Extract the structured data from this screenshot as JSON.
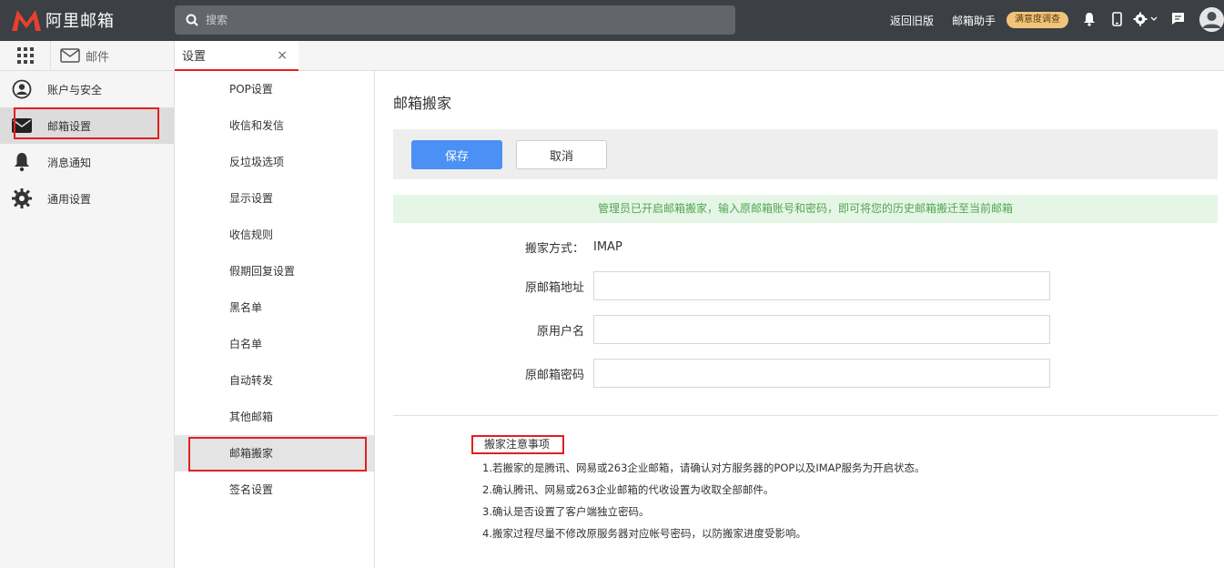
{
  "app": {
    "logo_text": "阿里邮箱"
  },
  "search": {
    "placeholder": "搜索"
  },
  "header": {
    "back_old": "返回旧版",
    "assistant": "邮箱助手",
    "survey": "满意度调查"
  },
  "leftnav": {
    "mail_label": "邮件",
    "items": [
      {
        "label": "账户与安全",
        "icon": "user-circle-icon"
      },
      {
        "label": "邮箱设置",
        "icon": "envelope-icon"
      },
      {
        "label": "消息通知",
        "icon": "bell-icon"
      },
      {
        "label": "通用设置",
        "icon": "gear-icon"
      }
    ]
  },
  "tab": {
    "label": "设置",
    "close": "×"
  },
  "submenu": {
    "items": [
      "POP设置",
      "收信和发信",
      "反垃圾选项",
      "显示设置",
      "收信规则",
      "假期回复设置",
      "黑名单",
      "白名单",
      "自动转发",
      "其他邮箱",
      "邮箱搬家",
      "签名设置"
    ]
  },
  "main": {
    "title": "邮箱搬家",
    "save": "保存",
    "cancel": "取消",
    "notice": "管理员已开启邮箱搬家，输入原邮箱账号和密码，即可将您的历史邮箱搬迁至当前邮箱",
    "method_label": "搬家方式：",
    "method_value": "IMAP",
    "address_label": "原邮箱地址",
    "address_value": "",
    "username_label": "原用户名",
    "username_value": "",
    "password_label": "原邮箱密码",
    "password_value": "",
    "notes_title": "搬家注意事项",
    "notes": [
      "1.若搬家的是腾讯、网易或263企业邮箱，请确认对方服务器的POP以及IMAP服务为开启状态。",
      "2.确认腾讯、网易或263企业邮箱的代收设置为收取全部邮件。",
      "3.确认是否设置了客户端独立密码。",
      "4.搬家过程尽量不修改原服务器对应帐号密码，以防搬家进度受影响。"
    ]
  },
  "colors": {
    "accent": "#4a90f5",
    "highlight": "#e02020",
    "topbar": "#3c3f44",
    "notice_bg": "#e6f6e6"
  }
}
